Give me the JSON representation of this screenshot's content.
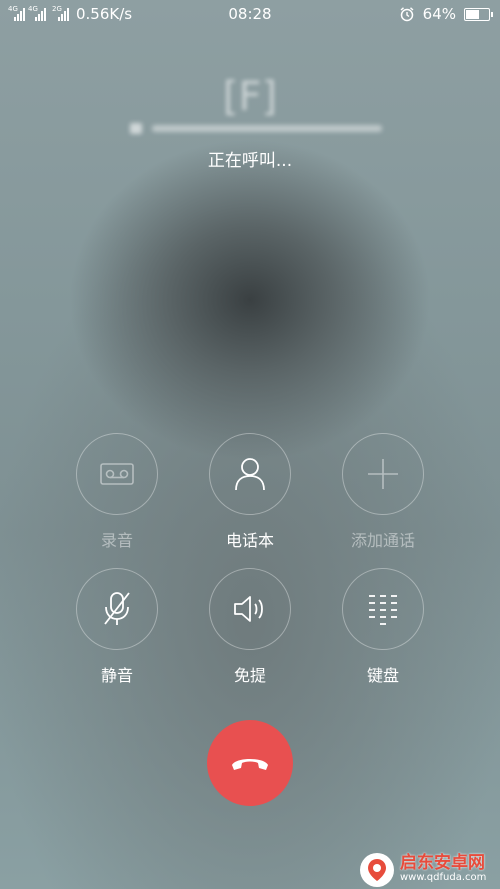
{
  "status_bar": {
    "network_primary": "4G",
    "network_secondary": "4G",
    "network_tertiary": "2G",
    "speed": "0.56K/s",
    "time": "08:28",
    "battery_percent": "64%",
    "battery_level": 0.64,
    "icons": [
      "signal-icon",
      "alarm-icon",
      "battery-icon"
    ]
  },
  "call": {
    "contact_initial": "[F]",
    "status": "正在呼叫..."
  },
  "actions": [
    {
      "label": "录音",
      "icon": "record-icon",
      "enabled": false
    },
    {
      "label": "电话本",
      "icon": "contacts-icon",
      "enabled": true
    },
    {
      "label": "添加通话",
      "icon": "add-call-icon",
      "enabled": false
    },
    {
      "label": "静音",
      "icon": "mute-icon",
      "enabled": true
    },
    {
      "label": "免提",
      "icon": "speaker-icon",
      "enabled": true
    },
    {
      "label": "键盘",
      "icon": "keypad-icon",
      "enabled": true
    }
  ],
  "hangup": {
    "icon": "hangup-icon",
    "color": "#e85050"
  },
  "watermark": {
    "text": "启东安卓网",
    "url": "www.qdfuda.com"
  },
  "colors": {
    "hangup_red": "#e85050",
    "watermark_red": "#e74c3c"
  }
}
